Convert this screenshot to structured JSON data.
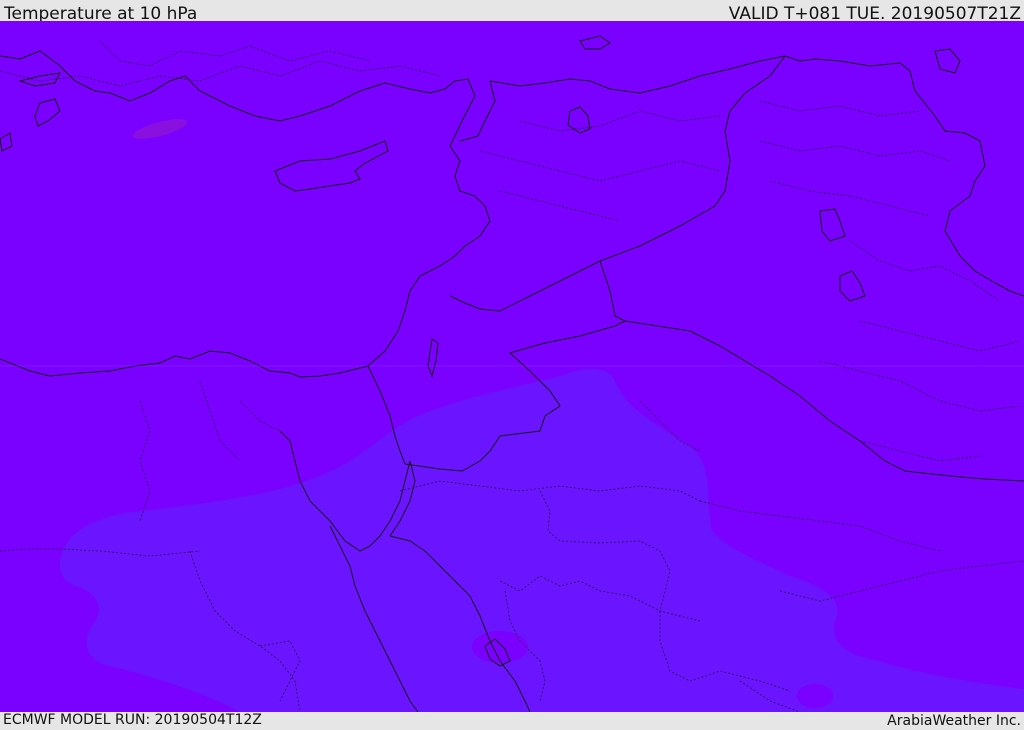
{
  "header": {
    "title": "Temperature at 10 hPa",
    "valid": "VALID T+081 TUE. 20190507T21Z"
  },
  "footer": {
    "model_run": "ECMWF MODEL RUN: 20190504T12Z",
    "brand": "ArabiaWeather Inc."
  },
  "colors": {
    "field_warm": "#7a00ff",
    "field_cool": "#6a14ff",
    "field_spot": "#8a10e0",
    "coast_line": "#1a1a1a",
    "border_line": "#1a1a1a"
  }
}
